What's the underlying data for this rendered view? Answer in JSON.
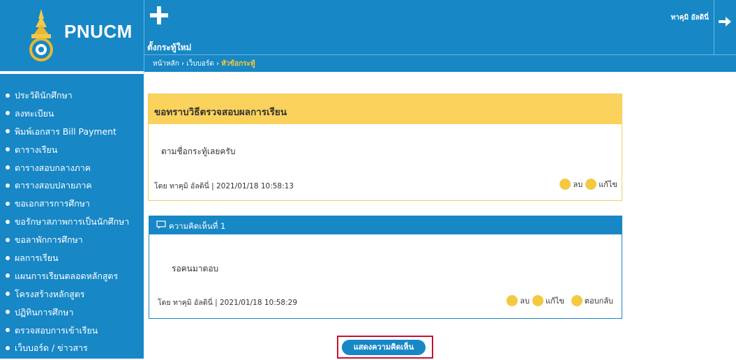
{
  "app": {
    "logo_text": "PNUCM"
  },
  "sidebar": {
    "items": [
      {
        "label": "ประวัตินักศึกษา"
      },
      {
        "label": "ลงทะเบียน"
      },
      {
        "label": "พิมพ์เอกสาร Bill Payment"
      },
      {
        "label": "ตารางเรียน"
      },
      {
        "label": "ตารางสอบกลางภาค"
      },
      {
        "label": "ตารางสอบปลายภาค"
      },
      {
        "label": "ขอเอกสารการศึกษา"
      },
      {
        "label": "ขอรักษาสภาพการเป็นนักศึกษา"
      },
      {
        "label": "ขอลาพักการศึกษา"
      },
      {
        "label": "ผลการเรียน"
      },
      {
        "label": "แผนการเรียนตลอดหลักสูตร"
      },
      {
        "label": "โครงสร้างหลักสูตร"
      },
      {
        "label": "ปฏิทินการศึกษา"
      },
      {
        "label": "ตรวจสอบการเข้าเรียน"
      },
      {
        "label": "เว็บบอร์ด / ข่าวสาร"
      }
    ]
  },
  "header": {
    "new_post_label": "ตั้งกระทู้ใหม่",
    "username": "ทาคุมิ อัลดินี่",
    "icons": {
      "new_post": "plus-icon",
      "logout": "arrow-right-icon"
    }
  },
  "breadcrumb": {
    "home": "หน้าหลัก",
    "sep1": " › ",
    "board": "เว็บบอร์ด",
    "sep2": " › ",
    "current": "หัวข้อกระทู้"
  },
  "topic": {
    "title": "ขอทราบวิธีตรวจสอบผลการเรียน",
    "body": "ตามชื่อกระทู้เลยครับ",
    "meta": "โดย ทาคุมิ อัลดินี่ | 2021/01/18 10:58:13",
    "delete_label": "ลบ",
    "edit_label": "แก้ไข"
  },
  "comment": {
    "title": "ความคิดเห็นที่ 1",
    "body": "รอคนมาตอบ",
    "meta": "โดย ทาคุมิ อัลดินี่ | 2021/01/18 10:58:29",
    "delete_label": "ลบ",
    "edit_label": "แก้ไข",
    "reply_label": "ตอบกลับ"
  },
  "show_comments_label": "แสดงความคิดเห็น",
  "colors": {
    "primary": "#1787c6",
    "accent_yellow": "#fbd25b",
    "highlight_red": "#c8102e"
  }
}
